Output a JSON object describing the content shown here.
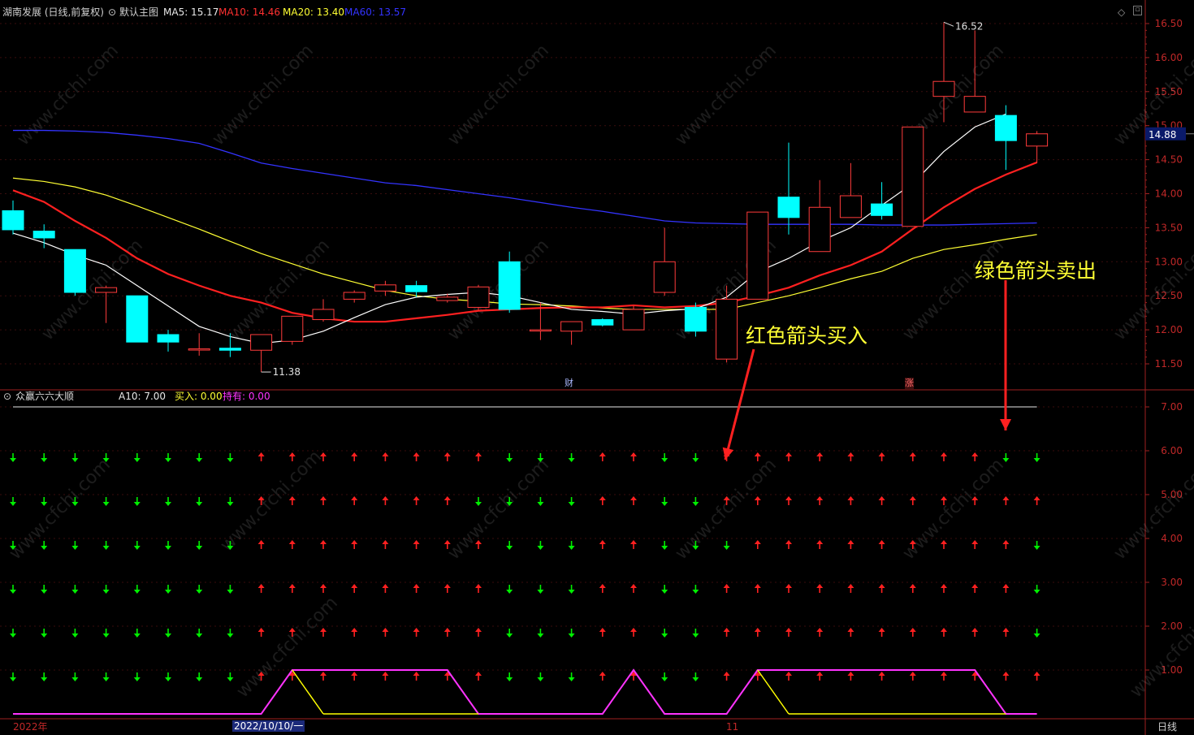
{
  "header": {
    "stock_title": "湖南发展 (日线,前复权)",
    "indicator_name": "默认主图",
    "ma5_label": "MA5: 15.17",
    "ma10_label": "MA10: 14.46",
    "ma20_label": "MA20: 13.40",
    "ma60_label": "MA60: 13.57"
  },
  "sub_header": {
    "name": "众赢六六大顺",
    "a10": "A10: 7.00",
    "buy": "买入: 0.00",
    "hold": "持有: 0.00"
  },
  "annotations": {
    "buy_text": "红色箭头买入",
    "sell_text": "绿色箭头卖出"
  },
  "markers": {
    "cai": "财",
    "zhang": "涨"
  },
  "footer": {
    "year": "2022年",
    "date": "2022/10/10/一",
    "month": "11",
    "period": "日线"
  },
  "price_axis": {
    "ticks": [
      "16.50",
      "16.00",
      "15.50",
      "15.00",
      "14.50",
      "14.00",
      "13.50",
      "13.00",
      "12.50",
      "12.00",
      "11.50"
    ],
    "current": "14.88",
    "high_label": "16.52",
    "low_label": "11.38"
  },
  "indicator_axis": {
    "ticks": [
      "7.00",
      "6.00",
      "5.00",
      "4.00",
      "3.00",
      "2.00",
      "1.00"
    ]
  },
  "watermark": "www.cfchi.com",
  "colors": {
    "up": "#ff3b3b",
    "down": "#00ffff",
    "ma5": "#ffffff",
    "ma10": "#ff2020",
    "ma20": "#ffff33",
    "ma60": "#3333ff",
    "buy_arrow": "#ff2020",
    "sell_arrow": "#00ee00",
    "hold_line": "#ff33ff",
    "buy_line": "#ffff00",
    "axis": "#a02020",
    "tick_text": "#c02828"
  },
  "chart_data": [
    {
      "type": "candlestick",
      "ylim": [
        11.3,
        16.7
      ],
      "candles": [
        {
          "o": 13.75,
          "c": 13.47,
          "h": 13.9,
          "l": 13.4
        },
        {
          "o": 13.45,
          "c": 13.35,
          "h": 13.55,
          "l": 13.2
        },
        {
          "o": 13.18,
          "c": 12.55,
          "h": 13.18,
          "l": 12.5
        },
        {
          "o": 12.55,
          "c": 12.62,
          "h": 12.65,
          "l": 12.1
        },
        {
          "o": 12.5,
          "c": 11.82,
          "h": 12.5,
          "l": 11.82
        },
        {
          "o": 11.93,
          "c": 11.82,
          "h": 12.0,
          "l": 11.68
        },
        {
          "o": 11.72,
          "c": 11.72,
          "h": 11.95,
          "l": 11.62
        },
        {
          "o": 11.73,
          "c": 11.7,
          "h": 11.95,
          "l": 11.6
        },
        {
          "o": 11.7,
          "c": 11.93,
          "h": 11.93,
          "l": 11.38
        },
        {
          "o": 11.83,
          "c": 12.2,
          "h": 12.2,
          "l": 11.78
        },
        {
          "o": 12.15,
          "c": 12.3,
          "h": 12.45,
          "l": 12.12
        },
        {
          "o": 12.45,
          "c": 12.55,
          "h": 12.58,
          "l": 12.4
        },
        {
          "o": 12.57,
          "c": 12.66,
          "h": 12.72,
          "l": 12.5
        },
        {
          "o": 12.65,
          "c": 12.56,
          "h": 12.72,
          "l": 12.48
        },
        {
          "o": 12.43,
          "c": 12.48,
          "h": 12.53,
          "l": 12.4
        },
        {
          "o": 12.33,
          "c": 12.63,
          "h": 12.66,
          "l": 12.28
        },
        {
          "o": 13.0,
          "c": 12.3,
          "h": 13.15,
          "l": 12.25
        },
        {
          "o": 12.0,
          "c": 12.0,
          "h": 12.4,
          "l": 11.85
        },
        {
          "o": 11.98,
          "c": 12.12,
          "h": 12.12,
          "l": 11.78
        },
        {
          "o": 12.15,
          "c": 12.07,
          "h": 12.17,
          "l": 12.05
        },
        {
          "o": 12.0,
          "c": 12.3,
          "h": 12.35,
          "l": 12.0
        },
        {
          "o": 12.55,
          "c": 13.0,
          "h": 13.5,
          "l": 12.5
        },
        {
          "o": 12.33,
          "c": 11.98,
          "h": 12.4,
          "l": 11.9
        },
        {
          "o": 11.57,
          "c": 12.45,
          "h": 12.65,
          "l": 11.52
        },
        {
          "o": 12.45,
          "c": 13.73,
          "h": 13.73,
          "l": 12.45
        },
        {
          "o": 13.95,
          "c": 13.65,
          "h": 14.75,
          "l": 13.4
        },
        {
          "o": 13.15,
          "c": 13.8,
          "h": 14.2,
          "l": 13.15
        },
        {
          "o": 13.65,
          "c": 13.97,
          "h": 14.45,
          "l": 13.65
        },
        {
          "o": 13.85,
          "c": 13.68,
          "h": 14.17,
          "l": 13.62
        },
        {
          "o": 13.52,
          "c": 14.98,
          "h": 14.98,
          "l": 13.52
        },
        {
          "o": 15.43,
          "c": 15.65,
          "h": 16.52,
          "l": 15.05
        },
        {
          "o": 15.2,
          "c": 15.43,
          "h": 16.4,
          "l": 15.2
        },
        {
          "o": 15.15,
          "c": 14.78,
          "h": 15.3,
          "l": 14.35
        },
        {
          "o": 14.7,
          "c": 14.88,
          "h": 14.92,
          "l": 14.45
        }
      ],
      "ma5": [
        13.42,
        13.28,
        13.1,
        12.95,
        12.65,
        12.35,
        12.05,
        11.9,
        11.8,
        11.85,
        11.98,
        12.18,
        12.37,
        12.48,
        12.52,
        12.55,
        12.5,
        12.4,
        12.3,
        12.27,
        12.23,
        12.28,
        12.31,
        12.48,
        12.85,
        13.05,
        13.3,
        13.5,
        13.83,
        14.15,
        14.62,
        14.98,
        15.17
      ],
      "ma10": [
        14.05,
        13.88,
        13.6,
        13.35,
        13.05,
        12.82,
        12.65,
        12.5,
        12.4,
        12.25,
        12.17,
        12.12,
        12.12,
        12.17,
        12.22,
        12.28,
        12.3,
        12.32,
        12.33,
        12.33,
        12.36,
        12.33,
        12.35,
        12.4,
        12.5,
        12.62,
        12.8,
        12.95,
        13.15,
        13.48,
        13.8,
        14.07,
        14.28,
        14.46
      ],
      "ma20": [
        14.23,
        14.18,
        14.1,
        13.98,
        13.82,
        13.65,
        13.48,
        13.3,
        13.12,
        12.97,
        12.82,
        12.7,
        12.58,
        12.5,
        12.45,
        12.42,
        12.38,
        12.37,
        12.35,
        12.32,
        12.3,
        12.3,
        12.3,
        12.3,
        12.4,
        12.5,
        12.62,
        12.75,
        12.86,
        13.05,
        13.18,
        13.25,
        13.33,
        13.4
      ],
      "ma60": [
        14.93,
        14.93,
        14.92,
        14.9,
        14.86,
        14.81,
        14.74,
        14.6,
        14.45,
        14.37,
        14.3,
        14.23,
        14.16,
        14.12,
        14.06,
        14.0,
        13.94,
        13.87,
        13.8,
        13.74,
        13.67,
        13.6,
        13.57,
        13.56,
        13.55,
        13.55,
        13.55,
        13.55,
        13.54,
        13.54,
        13.54,
        13.55,
        13.56,
        13.57
      ]
    },
    {
      "type": "signal-grid",
      "ylim": [
        0,
        7.4
      ],
      "a10_line": 7.0,
      "signal_levels": [
        6,
        5,
        4,
        3,
        2,
        1
      ],
      "signals_row6": [
        "sell",
        "sell",
        "sell",
        "sell",
        "sell",
        "sell",
        "sell",
        "sell",
        "buy",
        "buy",
        "buy",
        "buy",
        "buy",
        "buy",
        "buy",
        "buy",
        "sell",
        "sell",
        "sell",
        "buy",
        "buy",
        "sell",
        "sell",
        "buy",
        "buy",
        "buy",
        "buy",
        "buy",
        "buy",
        "buy",
        "buy",
        "buy",
        "sell",
        "sell"
      ],
      "signals_row5": [
        "sell",
        "sell",
        "sell",
        "sell",
        "sell",
        "sell",
        "sell",
        "sell",
        "buy",
        "buy",
        "buy",
        "buy",
        "buy",
        "buy",
        "buy",
        "sell",
        "sell",
        "sell",
        "sell",
        "buy",
        "buy",
        "sell",
        "sell",
        "buy",
        "buy",
        "buy",
        "buy",
        "buy",
        "buy",
        "buy",
        "buy",
        "buy",
        "buy",
        "buy"
      ],
      "signals_row4": [
        "sell",
        "sell",
        "sell",
        "sell",
        "sell",
        "sell",
        "sell",
        "sell",
        "buy",
        "buy",
        "buy",
        "buy",
        "buy",
        "buy",
        "buy",
        "buy",
        "sell",
        "sell",
        "sell",
        "buy",
        "buy",
        "sell",
        "sell",
        "sell",
        "buy",
        "buy",
        "buy",
        "buy",
        "buy",
        "buy",
        "buy",
        "buy",
        "buy",
        "sell"
      ],
      "signals_row3": [
        "sell",
        "sell",
        "sell",
        "sell",
        "sell",
        "sell",
        "sell",
        "sell",
        "buy",
        "buy",
        "buy",
        "buy",
        "buy",
        "buy",
        "buy",
        "buy",
        "sell",
        "sell",
        "sell",
        "buy",
        "buy",
        "sell",
        "sell",
        "buy",
        "buy",
        "buy",
        "buy",
        "buy",
        "buy",
        "buy",
        "buy",
        "buy",
        "buy",
        "sell"
      ],
      "signals_row2": [
        "sell",
        "sell",
        "sell",
        "sell",
        "sell",
        "sell",
        "sell",
        "sell",
        "buy",
        "buy",
        "buy",
        "buy",
        "buy",
        "buy",
        "buy",
        "buy",
        "sell",
        "sell",
        "sell",
        "buy",
        "buy",
        "sell",
        "sell",
        "buy",
        "buy",
        "buy",
        "buy",
        "buy",
        "buy",
        "buy",
        "buy",
        "buy",
        "buy",
        "sell"
      ],
      "signals_row1": [
        "sell",
        "sell",
        "sell",
        "sell",
        "sell",
        "sell",
        "sell",
        "sell",
        "buy",
        "buy",
        "buy",
        "buy",
        "buy",
        "buy",
        "buy",
        "buy",
        "sell",
        "sell",
        "sell",
        "buy",
        "buy",
        "sell",
        "sell",
        "buy",
        "buy",
        "buy",
        "buy",
        "buy",
        "buy",
        "buy",
        "buy",
        "buy",
        "buy",
        "buy"
      ],
      "hold_line": [
        0,
        0,
        0,
        0,
        0,
        0,
        0,
        0,
        0,
        1,
        1,
        1,
        1,
        1,
        1,
        0,
        0,
        0,
        0,
        0,
        1,
        0,
        0,
        0,
        1,
        1,
        1,
        1,
        1,
        1,
        1,
        1,
        0,
        0
      ],
      "buy_line": [
        0,
        0,
        0,
        0,
        0,
        0,
        0,
        0,
        0,
        1,
        0,
        0,
        0,
        0,
        0,
        0,
        0,
        0,
        0,
        0,
        0,
        0,
        0,
        0,
        1,
        0,
        0,
        0,
        0,
        0,
        0,
        0,
        0,
        0
      ]
    }
  ]
}
